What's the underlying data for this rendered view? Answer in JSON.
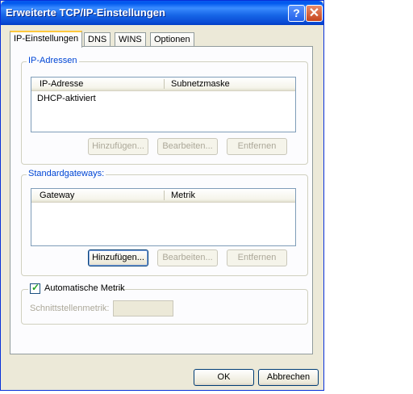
{
  "window": {
    "title": "Erweiterte TCP/IP-Einstellungen"
  },
  "titlebar_buttons": {
    "help": "?",
    "close": "✕"
  },
  "tabs": [
    {
      "label": "IP-Einstellungen",
      "active": true
    },
    {
      "label": "DNS",
      "active": false
    },
    {
      "label": "WINS",
      "active": false
    },
    {
      "label": "Optionen",
      "active": false
    }
  ],
  "ip_group": {
    "legend": "IP-Adressen",
    "columns": [
      "IP-Adresse",
      "Subnetzmaske"
    ],
    "rows": [
      [
        "DHCP-aktiviert",
        ""
      ]
    ],
    "buttons": {
      "add": "Hinzufügen...",
      "edit": "Bearbeiten...",
      "remove": "Entfernen"
    }
  },
  "gateway_group": {
    "legend": "Standardgateways:",
    "columns": [
      "Gateway",
      "Metrik"
    ],
    "rows": [],
    "buttons": {
      "add": "Hinzufügen...",
      "edit": "Bearbeiten...",
      "remove": "Entfernen"
    }
  },
  "metric": {
    "checkbox_label": "Automatische Metrik",
    "checked": true,
    "field_label": "Schnittstellenmetrik:",
    "field_value": ""
  },
  "footer": {
    "ok": "OK",
    "cancel": "Abbrechen"
  }
}
